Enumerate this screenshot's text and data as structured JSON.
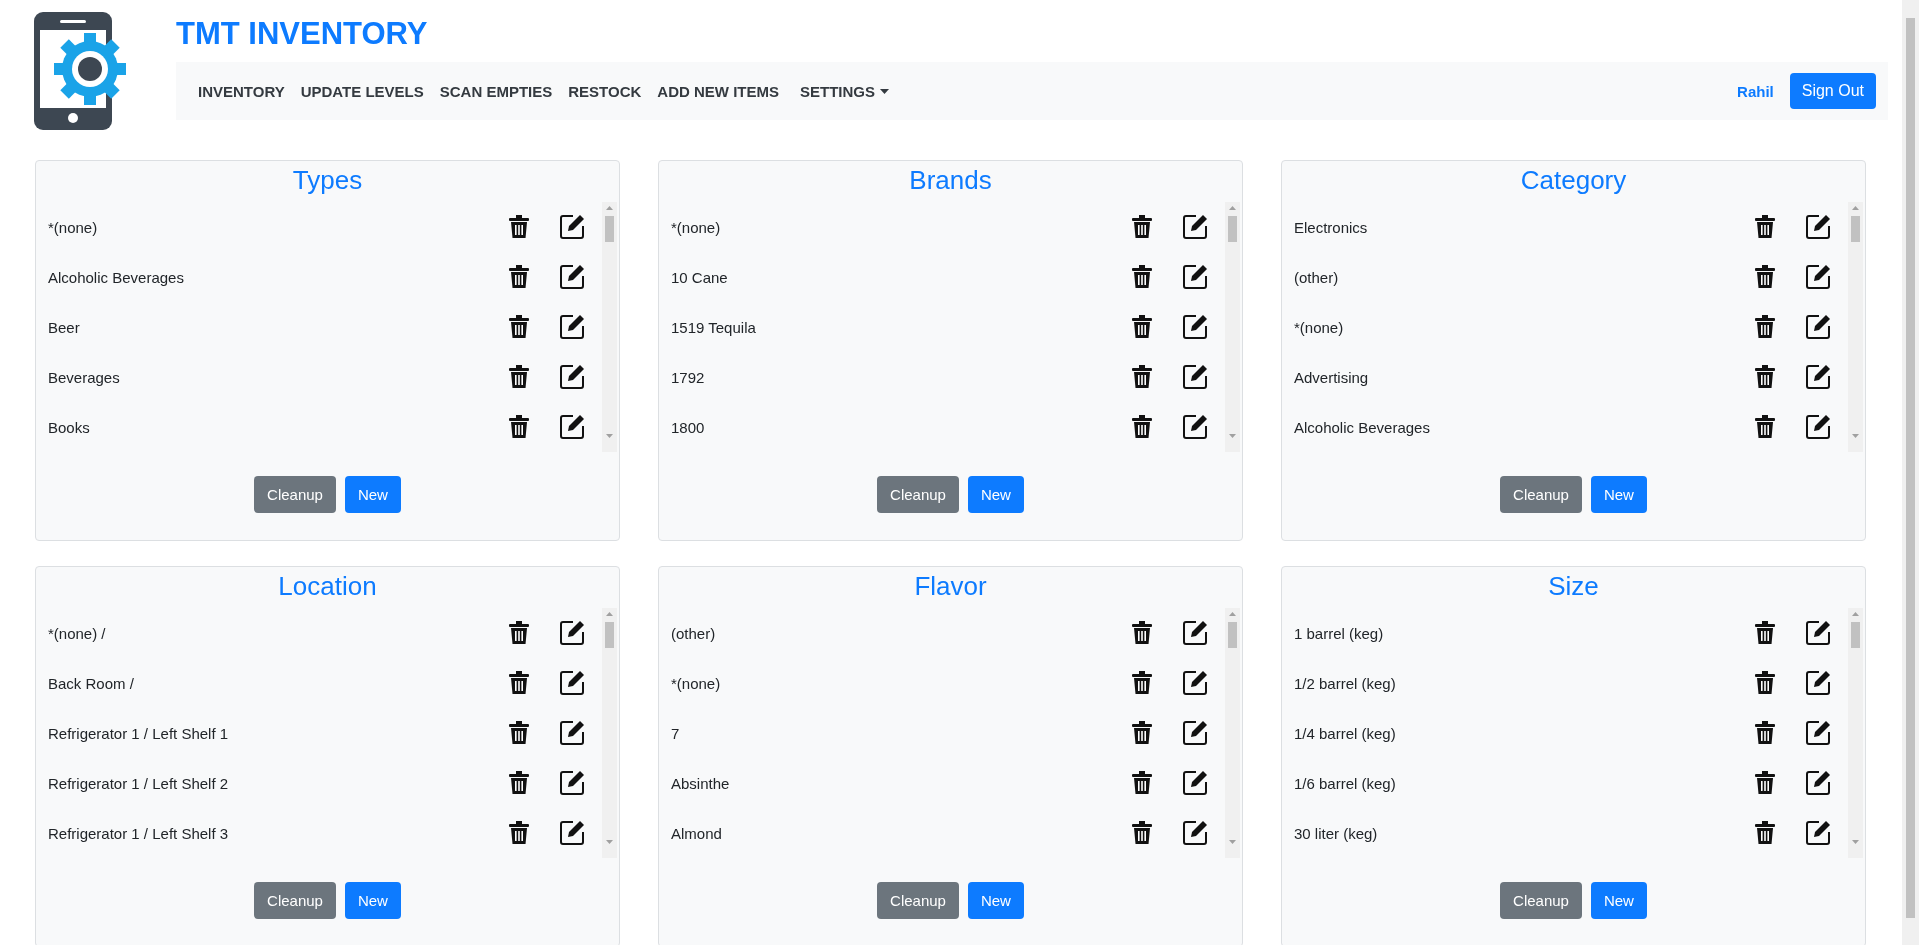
{
  "header": {
    "title": "TMT INVENTORY"
  },
  "nav": {
    "items": [
      {
        "label": "INVENTORY",
        "kind": "link"
      },
      {
        "label": "UPDATE LEVELS",
        "kind": "link"
      },
      {
        "label": "SCAN EMPTIES",
        "kind": "link"
      },
      {
        "label": "RESTOCK",
        "kind": "link"
      },
      {
        "label": "ADD NEW ITEMS",
        "kind": "link"
      },
      {
        "label": "SETTINGS",
        "kind": "dropdown"
      }
    ],
    "user": "Rahil",
    "sign_out": "Sign Out"
  },
  "panels": [
    {
      "title": "Types",
      "items": [
        "*(none)",
        "Alcoholic Beverages",
        "Beer",
        "Beverages",
        "Books"
      ],
      "buttons": [
        "Cleanup",
        "New"
      ]
    },
    {
      "title": "Brands",
      "items": [
        "*(none)",
        "10 Cane",
        "1519 Tequila",
        "1792",
        "1800"
      ],
      "buttons": [
        "Cleanup",
        "New"
      ]
    },
    {
      "title": "Category",
      "items": [
        "Electronics",
        "(other)",
        "*(none)",
        "Advertising",
        "Alcoholic Beverages"
      ],
      "buttons": [
        "Cleanup",
        "New"
      ]
    },
    {
      "title": "Location",
      "items": [
        "*(none) /",
        "Back Room /",
        "Refrigerator 1 / Left Shelf 1",
        "Refrigerator 1 / Left Shelf 2",
        "Refrigerator 1 / Left Shelf 3"
      ],
      "buttons": [
        "Cleanup",
        "New"
      ]
    },
    {
      "title": "Flavor",
      "items": [
        "(other)",
        "*(none)",
        "7",
        "Absinthe",
        "Almond"
      ],
      "buttons": [
        "Cleanup",
        "New"
      ]
    },
    {
      "title": "Size",
      "items": [
        "1 barrel (keg)",
        "1/2 barrel (keg)",
        "1/4 barrel (keg)",
        "1/6 barrel (keg)",
        "30 liter (keg)"
      ],
      "buttons": [
        "Cleanup",
        "New"
      ]
    }
  ]
}
